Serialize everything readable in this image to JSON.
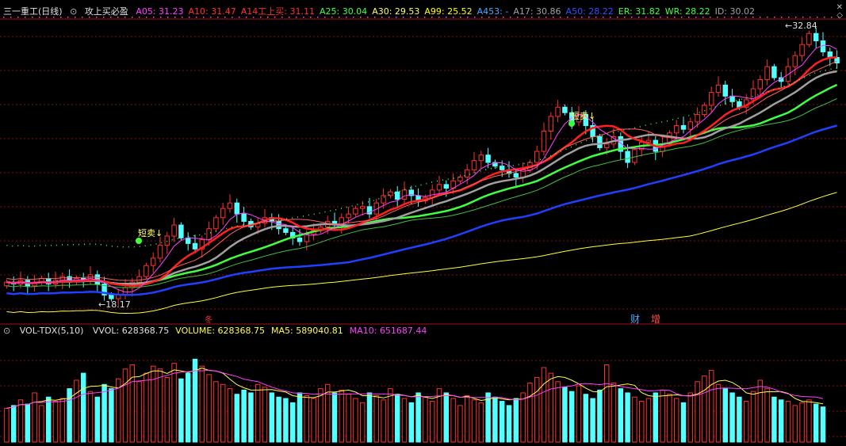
{
  "header": {
    "stock": "三一重工(日线)",
    "indicator_icon": "settings-circle-icon",
    "formula": "攻上买必盈",
    "items": [
      {
        "text": "A05: 31.23",
        "color": "#ff40ff"
      },
      {
        "text": "A10: 31.47",
        "color": "#ff3030"
      },
      {
        "text": "A14工上买: 31.11",
        "color": "#ff3030"
      },
      {
        "text": "A25: 30.04",
        "color": "#40ff40"
      },
      {
        "text": "A30: 29.53",
        "color": "#ffff66"
      },
      {
        "text": "A99: 25.52",
        "color": "#ffff00"
      },
      {
        "text": "A453: -",
        "color": "#4aa8ff"
      },
      {
        "text": "A17: 30.86",
        "color": "#a0a0a0"
      },
      {
        "text": "A50: 28.22",
        "color": "#3050ff"
      },
      {
        "text": "ER: 31.82",
        "color": "#40ff40"
      },
      {
        "text": "WR: 28.22",
        "color": "#40ff40"
      },
      {
        "text": "ID: 30.02",
        "color": "#a0a0a0"
      }
    ]
  },
  "volume_header": {
    "icon": "settings-circle-icon",
    "name": "VOL-TDX(5,10)",
    "items": [
      {
        "text": "VVOL: 628368.75",
        "color": "#e0e0e0"
      },
      {
        "text": "VOLUME: 628368.75",
        "color": "#ffff44"
      },
      {
        "text": "MA5: 589040.81",
        "color": "#ffff44"
      },
      {
        "text": "MA10: 651687.44",
        "color": "#ff40ff"
      }
    ]
  },
  "annotations": {
    "sell1": "短卖↓",
    "sell2": "短卖↓",
    "low_label": "←18.17",
    "high_label": "←32.84",
    "marker_cai": "财",
    "marker_zeng": "增",
    "marker_a": "冬"
  },
  "colors": {
    "up": "#ff3030",
    "down": "#54ffff",
    "grid": "#8a1010",
    "ma5": "#ff40ff",
    "ma10": "#ff2020",
    "ma17": "#a0a0a0",
    "ma25": "#40ff40",
    "ma50": "#2040ff",
    "ma99": "#ffff30",
    "vol_ma5": "#ffff44",
    "vol_ma10": "#ff40ff"
  },
  "chart_data": {
    "type": "candlestick",
    "price_range": [
      17.5,
      33.5
    ],
    "price_close_series": [
      19.3,
      19.2,
      19.4,
      19.1,
      19.3,
      19.5,
      19.2,
      19.4,
      19.6,
      19.3,
      19.5,
      19.4,
      19.7,
      19.2,
      18.6,
      18.4,
      18.6,
      19.0,
      19.3,
      19.6,
      20.2,
      20.6,
      21.3,
      21.8,
      22.4,
      21.7,
      21.4,
      21.1,
      21.6,
      22.2,
      22.8,
      23.3,
      23.6,
      23.0,
      22.6,
      22.3,
      22.5,
      22.8,
      22.6,
      22.2,
      22.0,
      21.7,
      21.5,
      21.9,
      22.1,
      22.3,
      22.6,
      22.4,
      22.8,
      23.0,
      23.3,
      23.4,
      23.0,
      23.6,
      24.0,
      24.2,
      23.8,
      24.3,
      24.0,
      23.7,
      23.9,
      24.3,
      24.6,
      24.4,
      24.8,
      25.0,
      25.4,
      25.9,
      26.2,
      25.8,
      25.6,
      25.4,
      25.2,
      25.0,
      25.4,
      25.8,
      26.4,
      27.5,
      28.3,
      28.8,
      28.5,
      28.0,
      28.4,
      27.8,
      27.2,
      26.6,
      26.8,
      27.2,
      26.4,
      25.8,
      26.5,
      26.9,
      27.0,
      26.4,
      26.8,
      27.4,
      27.8,
      27.6,
      28.0,
      28.4,
      28.9,
      29.6,
      30.0,
      29.4,
      29.1,
      28.8,
      29.2,
      29.8,
      30.3,
      31.0,
      30.4,
      30.2,
      31.0,
      31.6,
      32.2,
      32.8,
      32.4,
      31.8,
      31.5,
      31.2
    ],
    "volume_range": [
      0,
      1500000
    ],
    "volume_series": [
      480,
      520,
      600,
      540,
      700,
      520,
      640,
      580,
      620,
      760,
      880,
      980,
      720,
      640,
      820,
      760,
      900,
      1040,
      1100,
      860,
      980,
      1080,
      1040,
      920,
      1120,
      900,
      980,
      1180,
      1080,
      960,
      860,
      820,
      760,
      680,
      740,
      700,
      820,
      780,
      700,
      640,
      620,
      560,
      700,
      660,
      620,
      760,
      820,
      700,
      740,
      680,
      620,
      560,
      700,
      660,
      600,
      760,
      680,
      620,
      560,
      700,
      640,
      580,
      760,
      700,
      620,
      520,
      660,
      600,
      560,
      700,
      640,
      580,
      520,
      620,
      700,
      840,
      920,
      1060,
      980,
      860,
      780,
      720,
      800,
      680,
      620,
      740,
      1100,
      840,
      760,
      700,
      640,
      580,
      620,
      700,
      740,
      680,
      620,
      560,
      700,
      860,
      940,
      1020,
      820,
      760,
      700,
      640,
      580,
      720,
      880,
      760,
      640,
      600,
      580,
      520,
      560,
      600,
      540,
      500
    ],
    "ma_levels": {
      "A05": 31.23,
      "A10": 31.47,
      "A14": 31.11,
      "A25": 30.04,
      "A30": 29.53,
      "A99": 25.52,
      "A17": 30.86,
      "A50": 28.22
    },
    "high": 32.84,
    "low": 18.17
  }
}
